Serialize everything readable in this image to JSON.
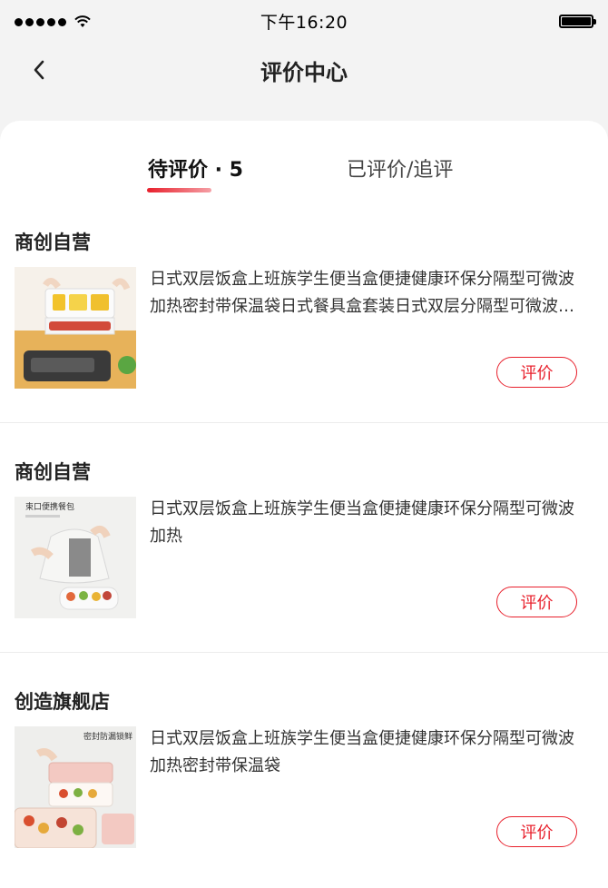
{
  "status_bar": {
    "time": "下午16:20"
  },
  "header": {
    "title": "评价中心"
  },
  "tabs": [
    {
      "label": "待评价 · 5"
    },
    {
      "label": "已评价/追评"
    }
  ],
  "orders": [
    {
      "shop": "商创自营",
      "title": "日式双层饭盒上班族学生便当盒便捷健康环保分隔型可微波加热密封带保温袋日式餐具盒套装日式双层分隔型可微波加热密封带保温袋",
      "button": "评价"
    },
    {
      "shop": "商创自营",
      "title": "日式双层饭盒上班族学生便当盒便捷健康环保分隔型可微波加热",
      "button": "评价",
      "image_caption": "束口便携餐包"
    },
    {
      "shop": "创造旗舰店",
      "title": "日式双层饭盒上班族学生便当盒便捷健康环保分隔型可微波加热密封带保温袋",
      "button": "评价",
      "image_caption": "密封防漏锁鲜"
    }
  ],
  "colors": {
    "accent": "#e8202c"
  }
}
